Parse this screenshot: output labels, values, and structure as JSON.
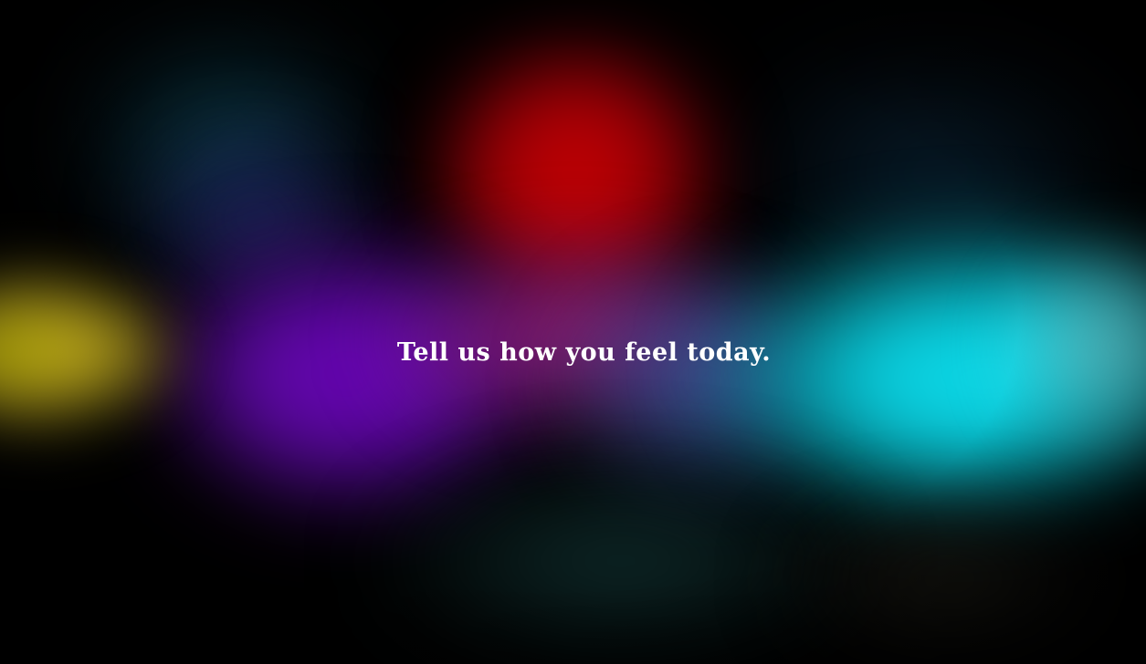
{
  "hero": {
    "headline": "Tell us how you feel today."
  },
  "colors": {
    "background": "#000000",
    "text": "#ffffff",
    "red": "#d00000",
    "purple": "#6a00b8",
    "yellow": "#e8e000",
    "cyan": "#10e0ee"
  }
}
